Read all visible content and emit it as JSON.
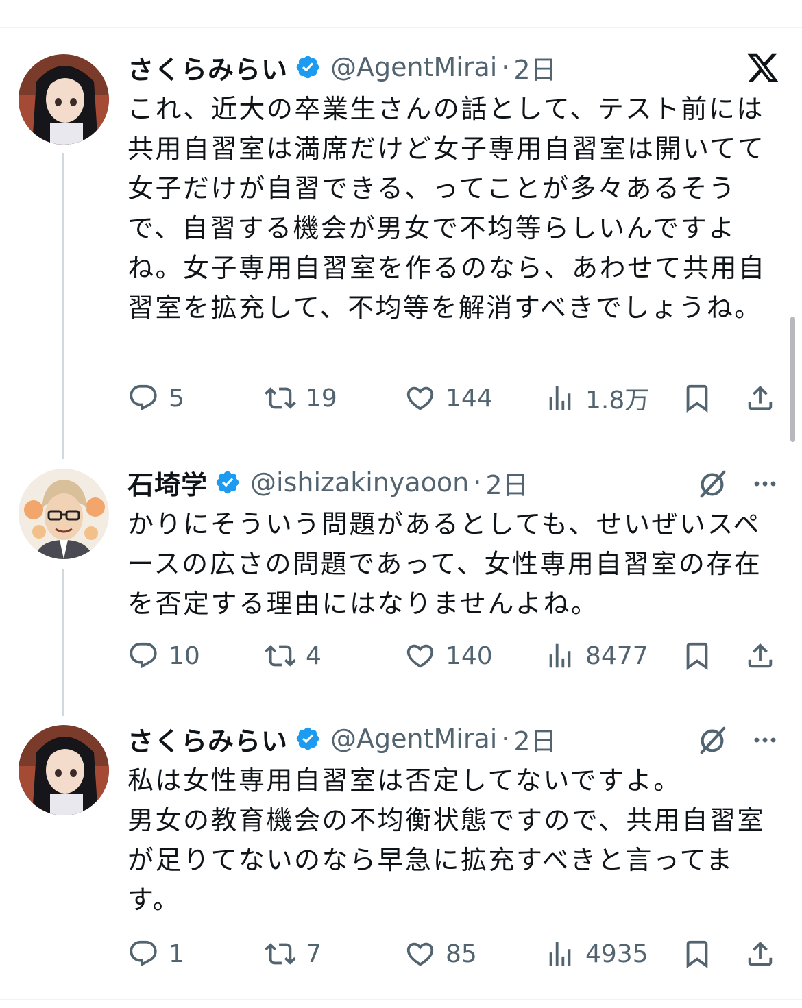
{
  "tweets": [
    {
      "display_name": "さくらみらい",
      "handle": "@AgentMirai",
      "separator": "·",
      "time": "2日",
      "text": "これ、近大の卒業生さんの話として、テスト前には共用自習室は満席だけど女子専用自習室は開いてて女子だけが自習できる、ってことが多々あるそうで、自習する機会が男女で不均等らしいんですよね。女子専用自習室を作るのなら、あわせて共用自習室を拡充して、不均等を解消すべきでしょうね。",
      "stats": {
        "replies": "5",
        "retweets": "19",
        "likes": "144",
        "views": "1.8万"
      },
      "corner_icon": "x-logo-icon"
    },
    {
      "display_name": "石埼学",
      "handle": "@ishizakinyaoon",
      "separator": "·",
      "time": "2日",
      "text": "かりにそういう問題があるとしても、せいぜいスペースの広さの問題であって、女性専用自習室の存在を否定する理由にはなりませんよね。",
      "stats": {
        "replies": "10",
        "retweets": "4",
        "likes": "140",
        "views": "8477"
      },
      "corner_icon": "grok-icon"
    },
    {
      "display_name": "さくらみらい",
      "handle": "@AgentMirai",
      "separator": "·",
      "time": "2日",
      "text": "私は女性専用自習室は否定してないですよ。\n男女の教育機会の不均衡状態ですので、共用自習室が足りてないのなら早急に拡充すべきと言ってます。",
      "stats": {
        "replies": "1",
        "retweets": "7",
        "likes": "85",
        "views": "4935"
      },
      "corner_icon": "grok-icon"
    }
  ],
  "colors": {
    "text": "#0f1419",
    "secondary": "#536471",
    "verified": "#1d9bf0",
    "thread_line": "#cfd9de"
  },
  "icons": [
    "reply-icon",
    "retweet-icon",
    "like-icon",
    "views-icon",
    "bookmark-icon",
    "share-icon",
    "more-icon",
    "verified-badge-icon"
  ]
}
